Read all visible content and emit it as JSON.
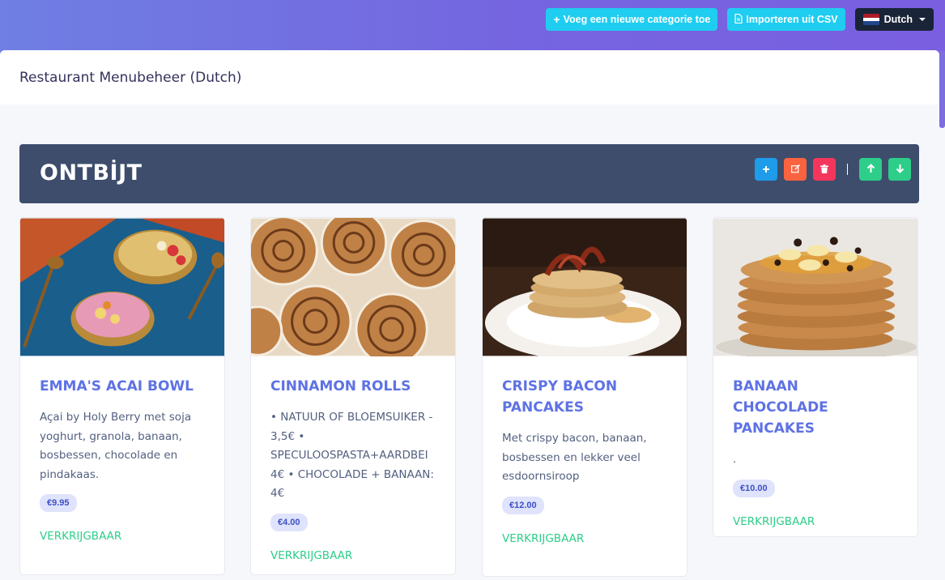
{
  "topbar": {
    "add_category_label": "Voeg een nieuwe categorie toe",
    "import_csv_label": "Importeren uit CSV",
    "language_label": "Dutch"
  },
  "page": {
    "title": "Restaurant Menubeheer (Dutch)"
  },
  "category": {
    "name": "ONTBİJT"
  },
  "items": [
    {
      "title": "EMMA'S ACAI BOWL",
      "description": "Açai by Holy Berry met soja yoghurt, granola, banaan, bosbessen, chocolade en pindakaas.",
      "price": "€9.95",
      "status": "VERKRIJGBAAR"
    },
    {
      "title": "CINNAMON ROLLS",
      "description": "• NATUUR OF BLOEMSUIKER - 3,5€ • SPECULOOSPASTA+AARDBEI 4€ • CHOCOLADE + BANAAN: 4€",
      "price": "€4.00",
      "status": "VERKRIJGBAAR"
    },
    {
      "title": "CRISPY BACON PANCAKES",
      "description": "Met crispy bacon, banaan, bosbessen en lekker veel esdoornsiroop",
      "price": "€12.00",
      "status": "VERKRIJGBAAR"
    },
    {
      "title": "BANAAN CHOCOLADE PANCAKES",
      "description": ".",
      "price": "€10.00",
      "status": "VERKRIJGBAAR"
    }
  ],
  "colors": {
    "accent": "#5e72e4",
    "cyan_button": "#1fcdf0",
    "category_bar": "#3e4d6c",
    "available": "#2dce89"
  }
}
